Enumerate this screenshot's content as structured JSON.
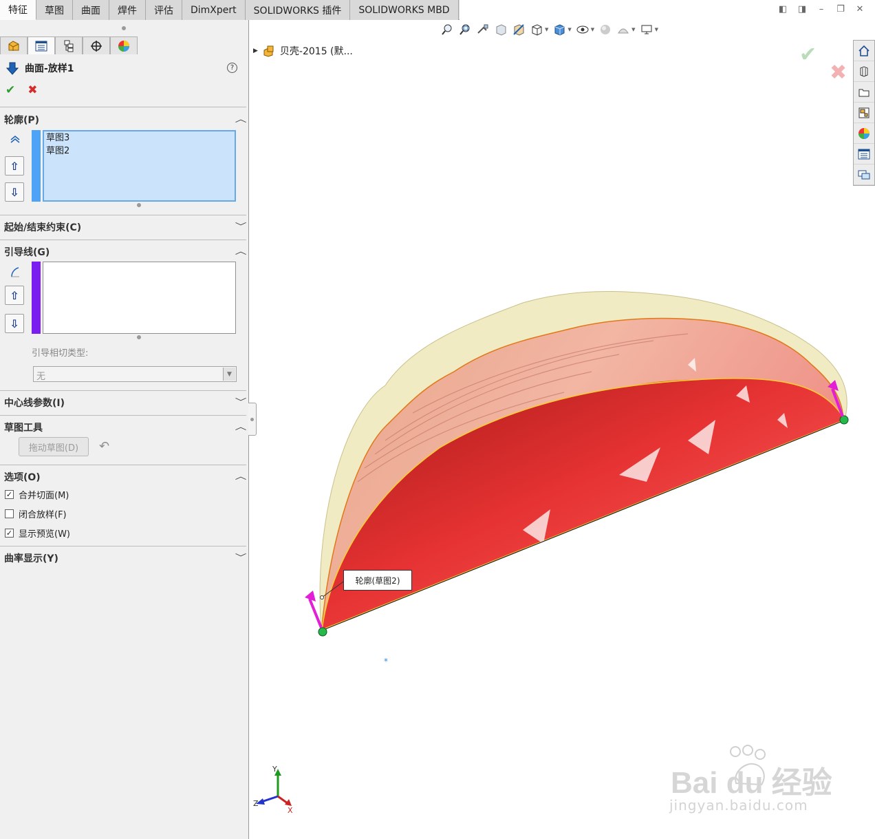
{
  "tabs": [
    "特征",
    "草图",
    "曲面",
    "焊件",
    "评估",
    "DimXpert",
    "SOLIDWORKS 插件",
    "SOLIDWORKS MBD"
  ],
  "active_tab": "特征",
  "feature": {
    "title": "曲面-放样1",
    "help": "?",
    "ok_symbol": "✔",
    "cancel_symbol": "✖"
  },
  "profiles": {
    "header": "轮廓(P)",
    "items": [
      "草图3",
      "草图2"
    ],
    "color": "#4fa3f7"
  },
  "start_end": {
    "header": "起始/结束约束(C)"
  },
  "guides": {
    "header": "引导线(G)",
    "color": "#7a1ff0",
    "tangency_label": "引导相切类型:",
    "tangency_value": "无"
  },
  "centerline": {
    "header": "中心线参数(I)"
  },
  "sketch_tools": {
    "header": "草图工具",
    "drag_button": "拖动草图(D)"
  },
  "options": {
    "header": "选项(O)",
    "merge_tangent": {
      "label": "合并切面(M)",
      "checked": true
    },
    "close_loft": {
      "label": "闭合放样(F)",
      "checked": false
    },
    "show_preview": {
      "label": "显示预览(W)",
      "checked": true
    }
  },
  "curvature": {
    "header": "曲率显示(Y)"
  },
  "tree": {
    "root_label": "贝壳-2015  (默..."
  },
  "callout": {
    "text": "轮廓(草图2)"
  },
  "triad": {
    "x": "X",
    "y": "Y",
    "z": "Z"
  },
  "watermark": {
    "brand": "Bai du 经验",
    "url": "jingyan.baidu.com"
  }
}
